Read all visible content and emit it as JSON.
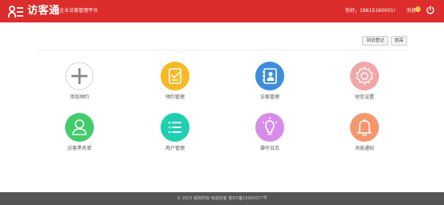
{
  "header": {
    "brand": "访客通",
    "subtitle": "企业访客管理平台",
    "greeting": "你好，18615160001!",
    "message_label": "消息",
    "accent": "#dc2c2c"
  },
  "actions": {
    "register_label": "到访登记",
    "prev_label": "提高"
  },
  "tiles": [
    {
      "label": "添加预约",
      "icon": "plus-icon",
      "color": "#ffffff"
    },
    {
      "label": "预约管理",
      "icon": "clipboard-check-icon",
      "color": "#f7b924"
    },
    {
      "label": "访客管理",
      "icon": "contact-book-icon",
      "color": "#3c8ddc"
    },
    {
      "label": "短信设置",
      "icon": "gear-icon",
      "color": "#f3a6a6"
    },
    {
      "label": "访客黑名单",
      "icon": "user-icon",
      "color": "#43cc6c"
    },
    {
      "label": "用户管理",
      "icon": "list-icon",
      "color": "#1fcfb1"
    },
    {
      "label": "操作日志",
      "icon": "bulb-icon",
      "color": "#d78ce8"
    },
    {
      "label": "消息通知",
      "icon": "bell-icon",
      "color": "#f5966b"
    }
  ],
  "footer": {
    "text": "© 2015 版权所有 哈通访客 鲁ICP备15004377号"
  }
}
